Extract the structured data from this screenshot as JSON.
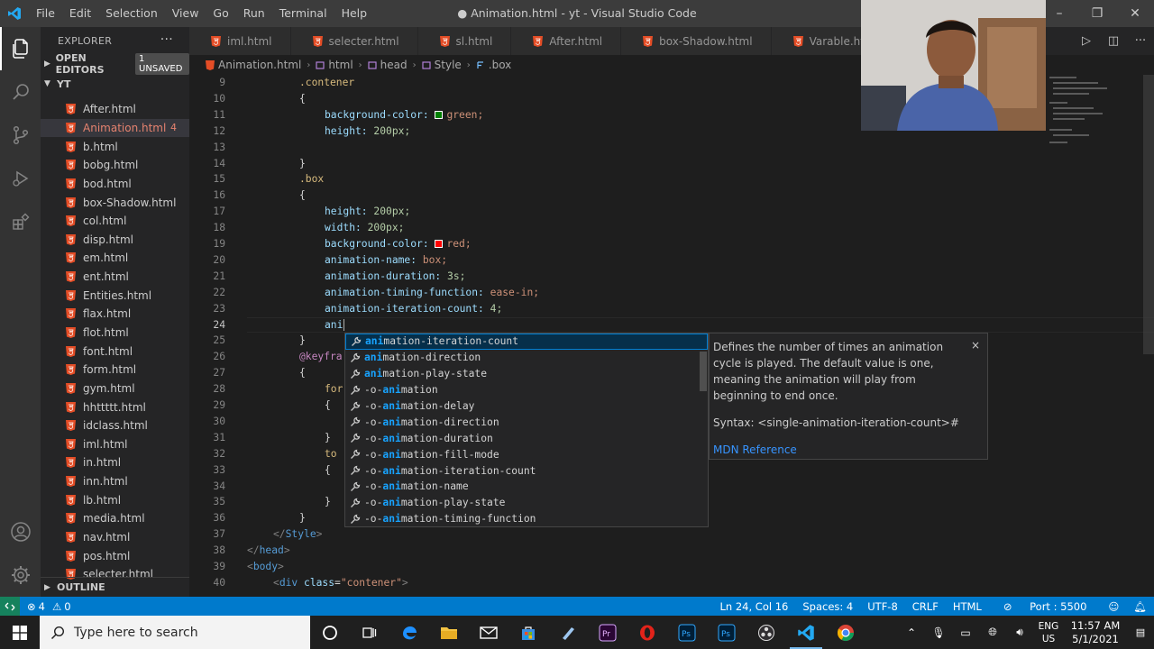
{
  "window": {
    "menu": [
      "File",
      "Edit",
      "Selection",
      "View",
      "Go",
      "Run",
      "Terminal",
      "Help"
    ],
    "title": "● Animation.html - yt - Visual Studio Code"
  },
  "explorer": {
    "header": "EXPLORER",
    "open_editors": "OPEN EDITORS",
    "unsaved_badge": "1 UNSAVED",
    "folder": "YT",
    "selected_count": "4",
    "files": [
      "After.html",
      "Animation.html",
      "b.html",
      "bobg.html",
      "bod.html",
      "box-Shadow.html",
      "col.html",
      "disp.html",
      "em.html",
      "ent.html",
      "Entities.html",
      "flax.html",
      "flot.html",
      "font.html",
      "form.html",
      "gym.html",
      "hhttttt.html",
      "idclass.html",
      "iml.html",
      "in.html",
      "inn.html",
      "lb.html",
      "media.html",
      "nav.html",
      "pos.html",
      "selecter.html"
    ],
    "outline": "OUTLINE"
  },
  "tabs": [
    "iml.html",
    "selecter.html",
    "sl.html",
    "After.html",
    "box-Shadow.html",
    "Varable.html"
  ],
  "breadcrumb": [
    "Animation.html",
    "html",
    "head",
    "Style",
    ".box"
  ],
  "editor": {
    "line_numbers": [
      "9",
      "10",
      "11",
      "12",
      "13",
      "14",
      "15",
      "16",
      "17",
      "18",
      "19",
      "20",
      "21",
      "22",
      "23",
      "24",
      "25",
      "26",
      "27",
      "28",
      "29",
      "30",
      "31",
      "32",
      "33",
      "34",
      "35",
      "36",
      "37",
      "38",
      "39",
      "40"
    ],
    "lines": {
      "l9": ".contener",
      "l10": "{",
      "l11_prop": "background-color:",
      "l11_val": "green;",
      "l12_prop": "height:",
      "l12_val": "200px;",
      "l14": "}",
      "l15": ".box",
      "l16": "{",
      "l17_prop": "height:",
      "l17_val": "200px;",
      "l18_prop": "width:",
      "l18_val": "200px;",
      "l19_prop": "background-color:",
      "l19_val": "red;",
      "l20_prop": "animation-name:",
      "l20_val": "box;",
      "l21_prop": "animation-duration:",
      "l21_val": "3s;",
      "l22_prop": "animation-timing-function:",
      "l22_val": "ease-in;",
      "l23_prop": "animation-iteration-count:",
      "l23_val": "4;",
      "l24": "ani",
      "l25": "}",
      "l26": "@keyfra",
      "l27": "{",
      "l28": "for",
      "l29": "{",
      "l31": "}",
      "l32": "to",
      "l33": "{",
      "l35": "}",
      "l36": "}",
      "l37_tag": "Style",
      "l38_tag": "head",
      "l39_tag": "body",
      "l40_tag": "div",
      "l40_attr": "class",
      "l40_str": "\"contener\""
    },
    "swatch_green": "#008000",
    "swatch_red": "#ff0000"
  },
  "suggest": {
    "items": [
      {
        "prefix": "",
        "hl": "ani",
        "rest": "mation-iteration-count"
      },
      {
        "prefix": "",
        "hl": "ani",
        "rest": "mation-direction"
      },
      {
        "prefix": "",
        "hl": "ani",
        "rest": "mation-play-state"
      },
      {
        "prefix": "-o-",
        "hl": "ani",
        "rest": "mation"
      },
      {
        "prefix": "-o-",
        "hl": "ani",
        "rest": "mation-delay"
      },
      {
        "prefix": "-o-",
        "hl": "ani",
        "rest": "mation-direction"
      },
      {
        "prefix": "-o-",
        "hl": "ani",
        "rest": "mation-duration"
      },
      {
        "prefix": "-o-",
        "hl": "ani",
        "rest": "mation-fill-mode"
      },
      {
        "prefix": "-o-",
        "hl": "ani",
        "rest": "mation-iteration-count"
      },
      {
        "prefix": "-o-",
        "hl": "ani",
        "rest": "mation-name"
      },
      {
        "prefix": "-o-",
        "hl": "ani",
        "rest": "mation-play-state"
      },
      {
        "prefix": "-o-",
        "hl": "ani",
        "rest": "mation-timing-function"
      }
    ],
    "details": {
      "description": "Defines the number of times an animation cycle is played. The default value is one, meaning the animation will play from beginning to end once.",
      "syntax": "Syntax: <single-animation-iteration-count>#",
      "reference": "MDN Reference",
      "close": "×"
    }
  },
  "statusbar": {
    "problems": "4",
    "warnings": "0",
    "position": "Ln 24, Col 16",
    "spaces": "Spaces: 4",
    "encoding": "UTF-8",
    "eol": "CRLF",
    "language": "HTML",
    "port": "Port : 5500"
  },
  "taskbar": {
    "search_placeholder": "Type here to search",
    "lang_top": "ENG",
    "lang_bottom": "US",
    "time": "11:57 AM",
    "date": "5/1/2021"
  },
  "colors": {
    "accent": "#007acc",
    "html_icon": "#e44d26"
  }
}
